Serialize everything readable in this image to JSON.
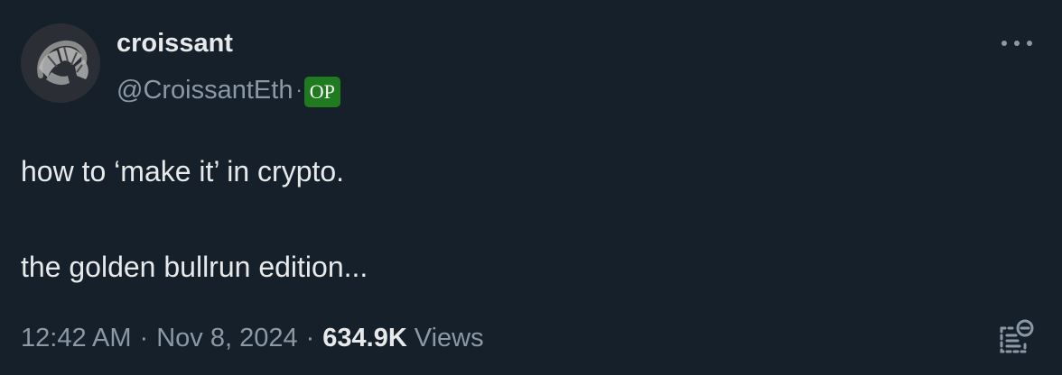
{
  "author": {
    "display_name": "croissant",
    "handle": "@CroissantEth",
    "separator": "·",
    "badge": "OP",
    "badge_color": "#1e7b1e"
  },
  "post": {
    "text": "how to ‘make it’ in crypto.\n\nthe golden bullrun edition..."
  },
  "meta": {
    "time": "12:42 AM",
    "separator": "·",
    "date": "Nov 8, 2024",
    "views_count": "634.9K",
    "views_label": "Views"
  },
  "icons": {
    "avatar": "croissant-avatar",
    "more": "more-horizontal-icon",
    "note": "community-note-icon"
  },
  "colors": {
    "background": "#15202b",
    "primary_text": "#e7e9ea",
    "secondary_text": "#8b98a5"
  }
}
